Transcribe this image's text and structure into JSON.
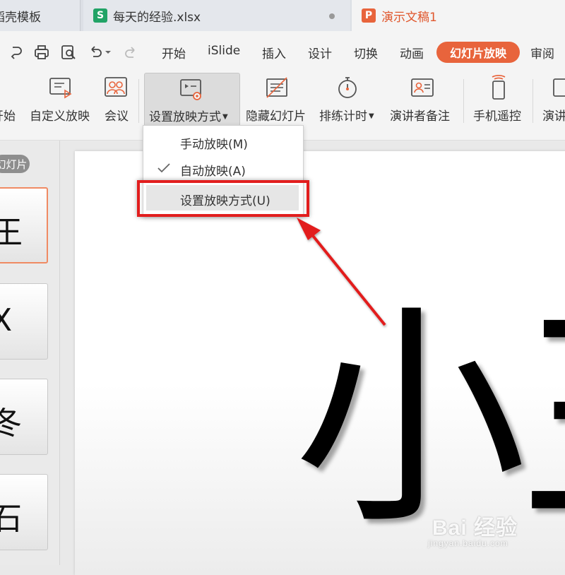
{
  "tabs": [
    {
      "label": "稻壳模板"
    },
    {
      "label": "每天的经验.xlsx",
      "icon": "S"
    },
    {
      "label": "演示文稿1",
      "icon": "P"
    }
  ],
  "quick_access": [
    "redo-icon",
    "print-icon",
    "print-preview-icon",
    "undo-icon",
    "undo-dropdown-icon",
    "repeat-icon"
  ],
  "menu": {
    "items": [
      "开始",
      "iSlide",
      "插入",
      "设计",
      "切换",
      "动画",
      "幻灯片放映",
      "审阅"
    ],
    "active": "幻灯片放映",
    "accent": "#e8643c"
  },
  "ribbon": {
    "buttons": [
      {
        "label": "开始"
      },
      {
        "label": "自定义放映"
      },
      {
        "label": "会议"
      },
      {
        "label": "设置放映方式"
      },
      {
        "label": "隐藏幻灯片"
      },
      {
        "label": "排练计时"
      },
      {
        "label": "演讲者备注"
      },
      {
        "label": "手机遥控"
      },
      {
        "label": "演讲"
      }
    ]
  },
  "dropdown": {
    "items": [
      {
        "label": "手动放映(M)",
        "checked": false
      },
      {
        "label": "自动放映(A)",
        "checked": true
      },
      {
        "label": "设置放映方式(U)",
        "checked": false,
        "highlighted": true
      }
    ]
  },
  "left_panel": {
    "label": "幻灯片",
    "thumbnails": [
      {
        "char": "王"
      },
      {
        "char": "X"
      },
      {
        "char": "冬"
      },
      {
        "char": "石"
      }
    ]
  },
  "slide": {
    "text": "小王"
  },
  "watermark": {
    "brand": "Bai 经验",
    "sub": "jingyan.baidu.com"
  }
}
